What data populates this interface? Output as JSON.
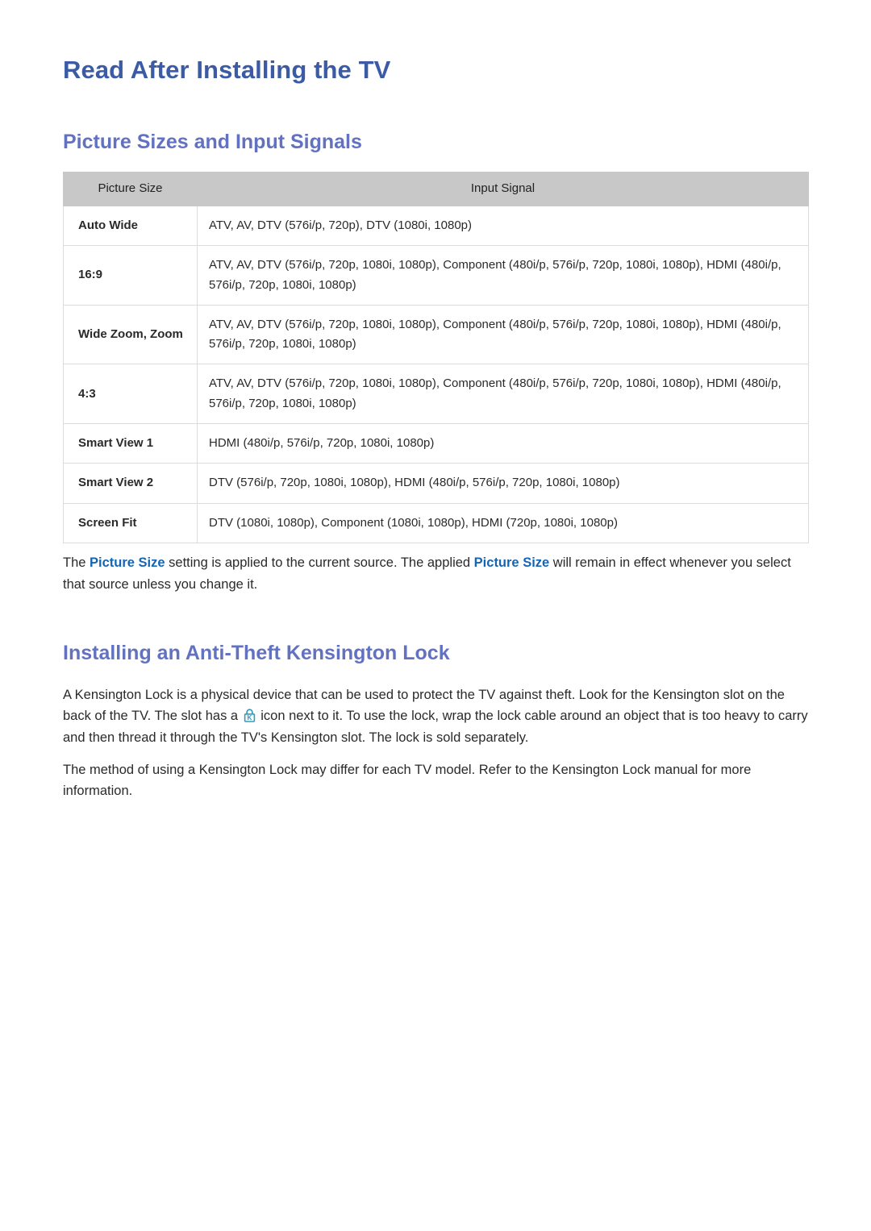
{
  "document": {
    "title": "Read After Installing the TV",
    "colors": {
      "title_blue": "#3b5ba5",
      "heading_blue": "#6272c0",
      "link_blue": "#1565b5",
      "table_header_gray": "#c8c8c8",
      "table_border": "#dcdcdc",
      "body_text": "#2a2a2a",
      "lock_icon_teal": "#2e9bbf"
    }
  },
  "section1": {
    "heading": "Picture Sizes and Input Signals",
    "table": {
      "headers": [
        "Picture Size",
        "Input Signal"
      ],
      "rows": [
        {
          "size": "Auto Wide",
          "signal": "ATV, AV, DTV (576i/p, 720p), DTV (1080i, 1080p)"
        },
        {
          "size": "16:9",
          "signal": "ATV, AV, DTV (576i/p, 720p, 1080i, 1080p), Component (480i/p, 576i/p, 720p, 1080i, 1080p), HDMI (480i/p, 576i/p, 720p, 1080i, 1080p)"
        },
        {
          "size": "Wide Zoom, Zoom",
          "signal": "ATV, AV, DTV (576i/p, 720p, 1080i, 1080p), Component (480i/p, 576i/p, 720p, 1080i, 1080p), HDMI (480i/p, 576i/p, 720p, 1080i, 1080p)"
        },
        {
          "size": "4:3",
          "signal": "ATV, AV, DTV (576i/p, 720p, 1080i, 1080p), Component (480i/p, 576i/p, 720p, 1080i, 1080p), HDMI (480i/p, 576i/p, 720p, 1080i, 1080p)"
        },
        {
          "size": "Smart View 1",
          "signal": "HDMI (480i/p, 576i/p, 720p, 1080i, 1080p)"
        },
        {
          "size": "Smart View 2",
          "signal": "DTV (576i/p, 720p, 1080i, 1080p), HDMI (480i/p, 576i/p, 720p, 1080i, 1080p)"
        },
        {
          "size": "Screen Fit",
          "signal": "DTV (1080i, 1080p), Component (1080i, 1080p), HDMI (720p, 1080i, 1080p)"
        }
      ]
    },
    "note": {
      "part1": "The ",
      "emphasis1": "Picture Size",
      "part2": " setting is applied to the current source. The applied ",
      "emphasis2": "Picture Size",
      "part3": " will remain in effect whenever you select that source unless you change it."
    }
  },
  "section2": {
    "heading": "Installing an Anti-Theft Kensington Lock",
    "paragraph1": {
      "part1": "A Kensington Lock is a physical device that can be used to protect the TV against theft. Look for the Kensington slot on the back of the TV. The slot has a ",
      "icon": "kensington-lock-icon",
      "part2": " icon next to it. To use the lock, wrap the lock cable around an object that is too heavy to carry and then thread it through the TV's Kensington slot. The lock is sold separately."
    },
    "paragraph2": "The method of using a Kensington Lock may differ for each TV model. Refer to the Kensington Lock manual for more information."
  }
}
